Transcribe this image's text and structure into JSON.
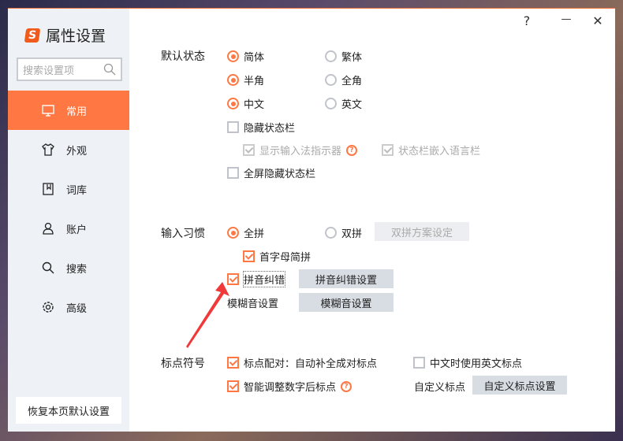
{
  "window": {
    "title": "属性设置",
    "search_placeholder": "搜索设置项",
    "help": "?",
    "minimize": "—",
    "close": "✕",
    "reset": "恢复本页默认设置"
  },
  "sidebar": {
    "items": [
      {
        "label": "常用",
        "icon": "monitor-icon"
      },
      {
        "label": "外观",
        "icon": "shirt-icon"
      },
      {
        "label": "词库",
        "icon": "book-icon"
      },
      {
        "label": "账户",
        "icon": "user-icon"
      },
      {
        "label": "搜索",
        "icon": "search-icon"
      },
      {
        "label": "高级",
        "icon": "gear-icon"
      }
    ]
  },
  "default_state": {
    "label": "默认状态",
    "simplified": "简体",
    "traditional": "繁体",
    "half": "半角",
    "full": "全角",
    "chinese": "中文",
    "english": "英文",
    "hide_status": "隐藏状态栏",
    "show_indicator": "显示输入法指示器",
    "embed_lang": "状态栏嵌入语言栏",
    "fullscreen_hide": "全屏隐藏状态栏"
  },
  "input_habit": {
    "label": "输入习惯",
    "quanpin": "全拼",
    "shuangpin": "双拼",
    "shuangpin_btn": "双拼方案设定",
    "initials": "首字母简拼",
    "correction": "拼音纠错",
    "correction_btn": "拼音纠错设置",
    "fuzzy_label": "模糊音设置",
    "fuzzy_btn": "模糊音设置"
  },
  "punctuation": {
    "label": "标点符号",
    "pairing": "标点配对：自动补全成对标点",
    "english_punct": "中文时使用英文标点",
    "smart_adjust": "智能调整数字后标点",
    "custom_label": "自定义标点",
    "custom_btn": "自定义标点设置"
  },
  "colors": {
    "accent": "#ff7843",
    "arrow": "#f03a3a"
  }
}
